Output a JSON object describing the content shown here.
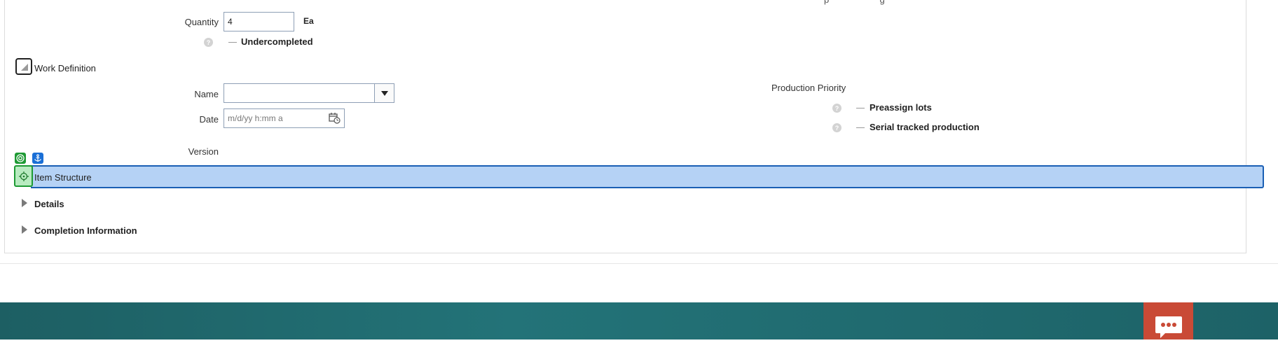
{
  "top": {
    "truncated_text": "p                    g",
    "quantity_label": "Quantity",
    "quantity_value": "4",
    "quantity_uom": "Ea",
    "undercompleted_label": "Undercompleted",
    "help_glyph": "?"
  },
  "work_definition": {
    "title": "Work Definition",
    "name_label": "Name",
    "name_value": "",
    "date_label": "Date",
    "date_placeholder": "m/d/yy h:mm a",
    "version_label": "Version",
    "production_priority_label": "Production Priority",
    "preassign_lots_label": "Preassign lots",
    "serial_tracked_label": "Serial tracked production"
  },
  "sections": {
    "item_structure": "Item Structure",
    "details": "Details",
    "completion_information": "Completion Information"
  },
  "colors": {
    "highlight": "#b5d2f5",
    "highlight_border": "#1a5fb4",
    "target_green": "#1e9a34",
    "anchor_blue": "#1a6fd6",
    "footer": "#1f6a6f",
    "chat": "#c94a36"
  },
  "icons": {
    "dropdown": "chevron-down-icon",
    "calendar": "calendar-icon",
    "chat": "chat-icon",
    "anchor": "anchor-icon",
    "target": "target-icon"
  }
}
